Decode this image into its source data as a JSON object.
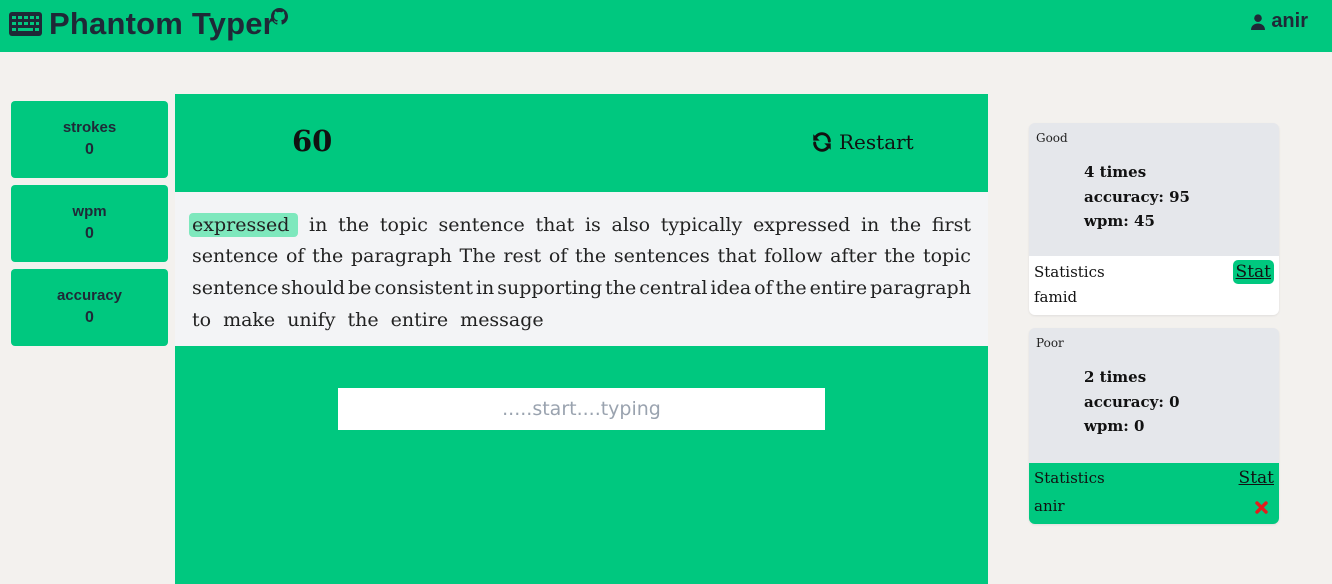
{
  "header": {
    "title": "Phantom Typer",
    "username": "anir"
  },
  "sidebar_stats": [
    {
      "label": "strokes",
      "value": "0"
    },
    {
      "label": "wpm",
      "value": "0"
    },
    {
      "label": "accuracy",
      "value": "0"
    }
  ],
  "game": {
    "timer": "60",
    "restart_label": "Restart",
    "lines": [
      [
        "expressed",
        "in",
        "the",
        "topic",
        "sentence",
        "that",
        "is",
        "also",
        "typically",
        "expressed",
        "in",
        "the",
        "first"
      ],
      [
        "sentence",
        "of",
        "the",
        "paragraph",
        "The",
        "rest",
        "of",
        "the",
        "sentences",
        "that",
        "follow",
        "after",
        "the",
        "topic"
      ],
      [
        "sentence",
        "should",
        "be",
        "consistent",
        "in",
        "supporting",
        "the",
        "central",
        "idea",
        "of",
        "the",
        "entire",
        "paragraph"
      ],
      [
        "to",
        "make",
        "unify",
        "the",
        "entire",
        "message"
      ]
    ],
    "active_word_index": 0,
    "input_placeholder": ".....start....typing",
    "input_value": ""
  },
  "history": [
    {
      "tag": "Good",
      "times": "4 times",
      "accuracy": "accuracy: 95",
      "wpm": "wpm: 45",
      "statistics_label": "Statistics",
      "stat_button": "Stat",
      "user": "famid"
    },
    {
      "tag": "Poor",
      "times": "2 times",
      "accuracy": "accuracy: 0",
      "wpm": "wpm: 0",
      "statistics_label": "Statistics",
      "stat_button": "Stat",
      "user": "anir"
    }
  ],
  "colors": {
    "brand_green": "#00c87f",
    "highlight": "#7ee8bd",
    "delete_red": "#e11d1d"
  },
  "icons": {
    "logo": "keyboard-icon",
    "repo": "github-icon",
    "user": "user-icon",
    "restart": "sync-icon",
    "delete": "close-x-icon"
  }
}
